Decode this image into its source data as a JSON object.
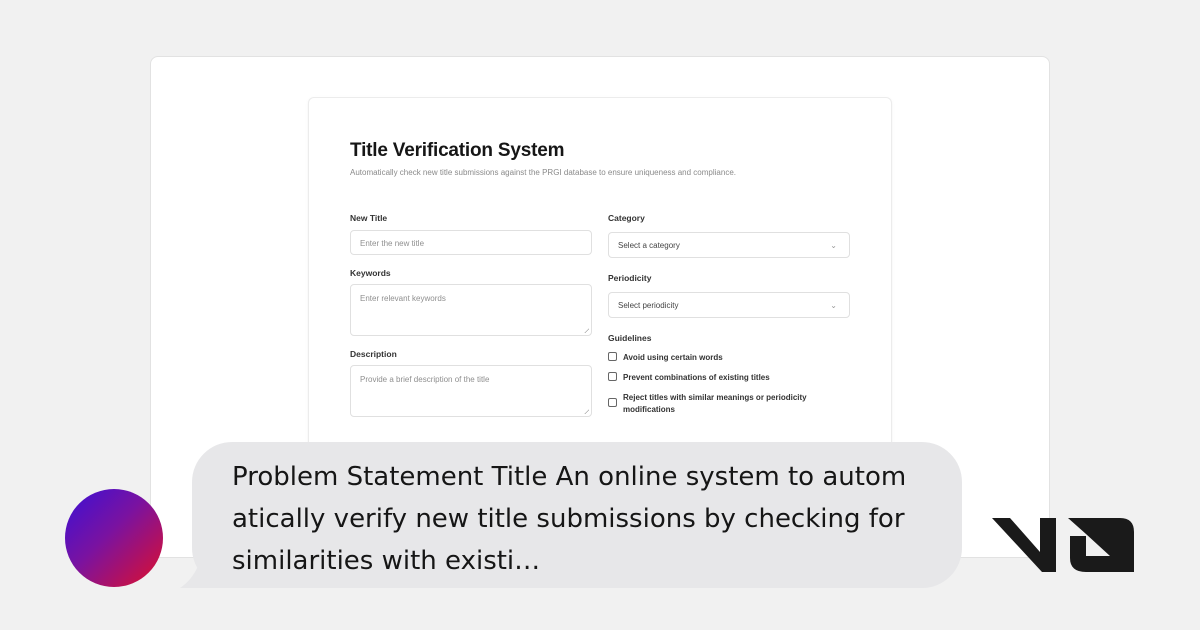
{
  "form": {
    "title": "Title Verification System",
    "subtitle": "Automatically check new title submissions against the PRGI database to ensure uniqueness and compliance.",
    "new_title": {
      "label": "New Title",
      "placeholder": "Enter the new title"
    },
    "keywords": {
      "label": "Keywords",
      "placeholder": "Enter relevant keywords"
    },
    "description": {
      "label": "Description",
      "placeholder": "Provide a brief description of the title"
    },
    "category": {
      "label": "Category",
      "value": "Select a category"
    },
    "periodicity": {
      "label": "Periodicity",
      "value": "Select periodicity"
    },
    "guidelines": {
      "label": "Guidelines",
      "items": [
        {
          "label": "Avoid using certain words",
          "checked": false
        },
        {
          "label": "Prevent combinations of existing titles",
          "checked": false
        },
        {
          "label": "Reject titles with similar meanings or periodicity modifications",
          "checked": false
        }
      ]
    }
  },
  "chat": {
    "message": "Problem Statement  Title An online system  to autom atically verify new title submissions by checking for similarities with existi…"
  },
  "colors": {
    "avatar_gradient": [
      "#3b10d6",
      "#e0102a"
    ],
    "bubble": "#e7e7e9",
    "logo": "#1a1a1a"
  },
  "icons": {
    "select_chevron": "chevron-down-icon",
    "brand": "v0-logo-icon"
  }
}
